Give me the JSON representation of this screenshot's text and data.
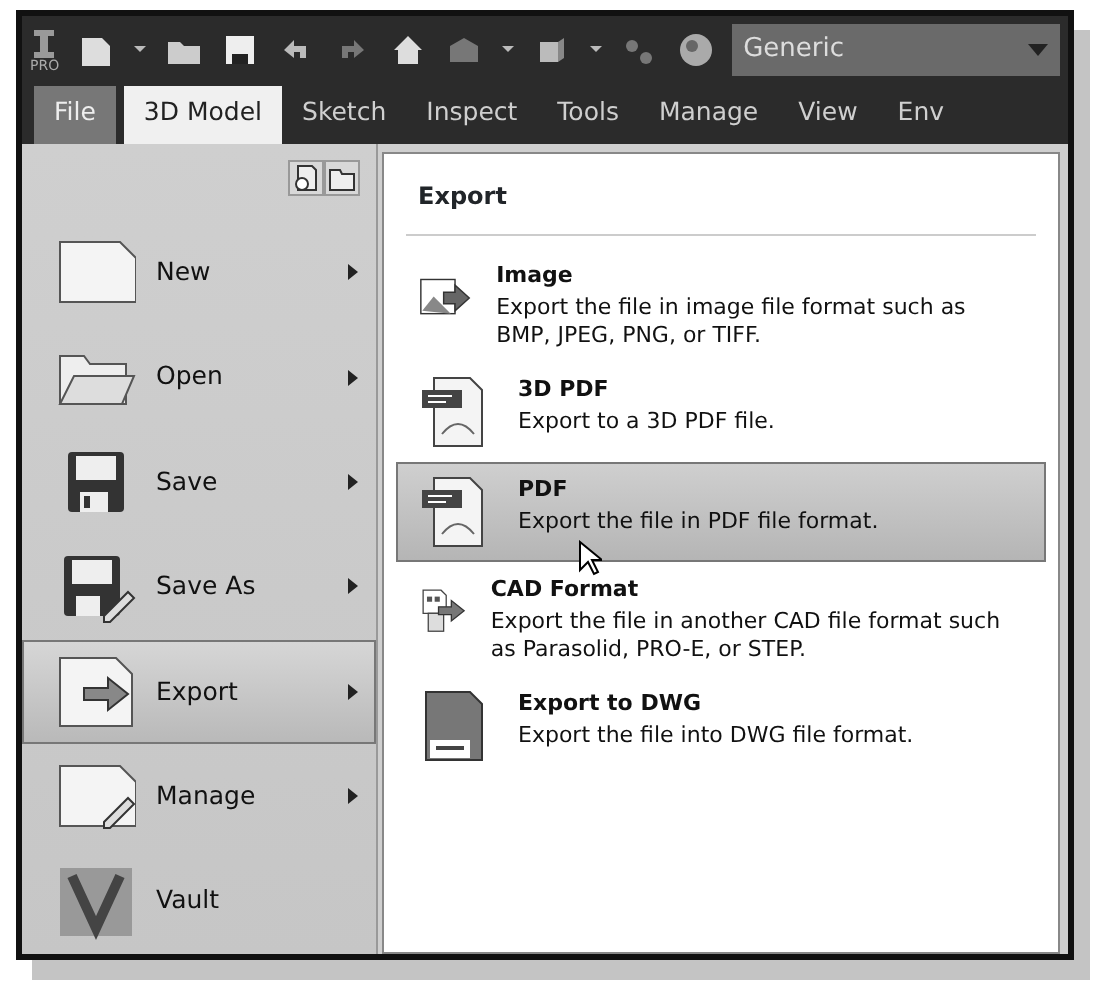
{
  "toolbar": {
    "logo_text": "PRO",
    "material_dropdown": {
      "value": "Generic"
    }
  },
  "tabs": [
    {
      "label": "File",
      "kind": "application",
      "selected": false
    },
    {
      "label": "3D Model",
      "kind": "tab",
      "selected": true
    },
    {
      "label": "Sketch",
      "kind": "tab",
      "selected": false
    },
    {
      "label": "Inspect",
      "kind": "tab",
      "selected": false
    },
    {
      "label": "Tools",
      "kind": "tab",
      "selected": false
    },
    {
      "label": "Manage",
      "kind": "tab",
      "selected": false
    },
    {
      "label": "View",
      "kind": "tab",
      "selected": false
    },
    {
      "label": "Env",
      "kind": "tab",
      "selected": false
    }
  ],
  "file_menu": {
    "items": [
      {
        "label": "New",
        "has_submenu": true,
        "selected": false
      },
      {
        "label": "Open",
        "has_submenu": true,
        "selected": false
      },
      {
        "label": "Save",
        "has_submenu": true,
        "selected": false
      },
      {
        "label": "Save As",
        "has_submenu": true,
        "selected": false
      },
      {
        "label": "Export",
        "has_submenu": true,
        "selected": true
      },
      {
        "label": "Manage",
        "has_submenu": true,
        "selected": false
      },
      {
        "label": "Vault",
        "has_submenu": false,
        "selected": false
      }
    ]
  },
  "export_panel": {
    "title": "Export",
    "items": [
      {
        "title": "Image",
        "description": "Export the file in image file format such as BMP, JPEG, PNG, or TIFF.",
        "selected": false
      },
      {
        "title": "3D PDF",
        "description": "Export to a 3D PDF file.",
        "selected": false
      },
      {
        "title": "PDF",
        "description": "Export the file in PDF file format.",
        "selected": true
      },
      {
        "title": "CAD Format",
        "description": "Export the file in another CAD file format such as Parasolid, PRO-E, or STEP.",
        "selected": false
      },
      {
        "title": "Export to DWG",
        "description": "Export the file into DWG file format.",
        "selected": false
      }
    ]
  }
}
